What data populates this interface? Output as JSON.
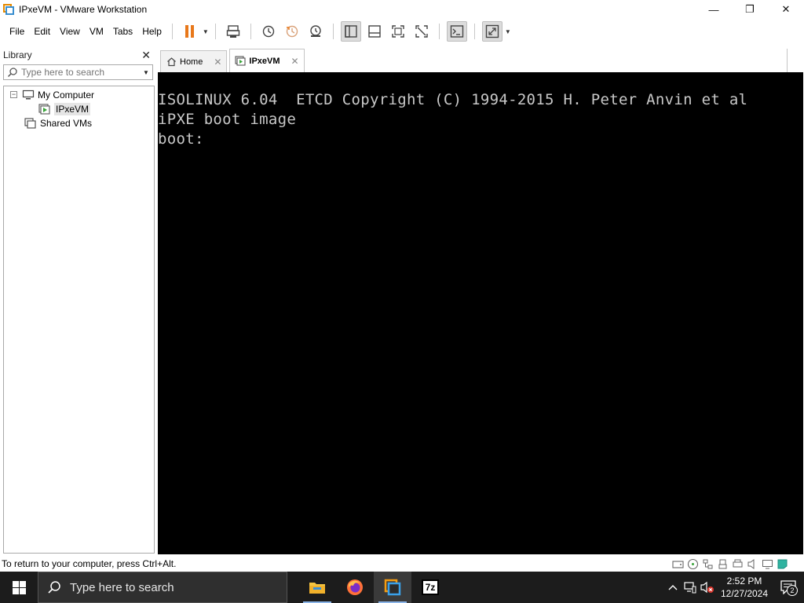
{
  "window": {
    "title": "IPxeVM - VMware Workstation",
    "controls": {
      "minimize": "—",
      "maximize": "❐",
      "close": "✕"
    }
  },
  "menu": [
    "File",
    "Edit",
    "View",
    "VM",
    "Tabs",
    "Help"
  ],
  "toolbar": {
    "icons": [
      "pause-icon",
      "send-ctrl-alt-del-icon",
      "snapshot-icon",
      "revert-snapshot-icon",
      "snapshot-manager-icon",
      "show-library-icon",
      "thumbnail-bar-icon",
      "fullscreen-icon",
      "unity-icon",
      "console-view-icon",
      "stretch-guest-icon"
    ]
  },
  "library": {
    "title": "Library",
    "close": "✕",
    "search_placeholder": "Type here to search",
    "tree": [
      {
        "label": "My Computer",
        "toggle": "−",
        "icon": "computer-icon"
      },
      {
        "label": "IPxeVM",
        "icon": "vm-running-icon",
        "selected": true
      },
      {
        "label": "Shared VMs",
        "icon": "shared-vms-icon"
      }
    ]
  },
  "tabs": [
    {
      "label": "Home",
      "icon": "home-icon",
      "close": "✕"
    },
    {
      "label": "IPxeVM",
      "icon": "vm-running-icon",
      "close": "✕",
      "active": true
    }
  ],
  "console": {
    "lines": [
      "ISOLINUX 6.04  ETCD Copyright (C) 1994-2015 H. Peter Anvin et al",
      "iPXE boot image",
      "boot:"
    ]
  },
  "statusbar": {
    "text": "To return to your computer, press Ctrl+Alt."
  },
  "taskbar": {
    "search_text": "Type here to search",
    "apps": [
      "file-explorer-icon",
      "firefox-icon",
      "vmware-workstation-icon",
      "7zip-icon"
    ],
    "sevenzip_label": "7z",
    "clock_time": "2:52 PM",
    "clock_date": "12/27/2024",
    "notification_count": "2"
  },
  "colors": {
    "accent_orange": "#e8781a",
    "console_bg": "#000000",
    "console_fg": "#c8c8c8",
    "taskbar_bg": "#1c1c1c"
  }
}
